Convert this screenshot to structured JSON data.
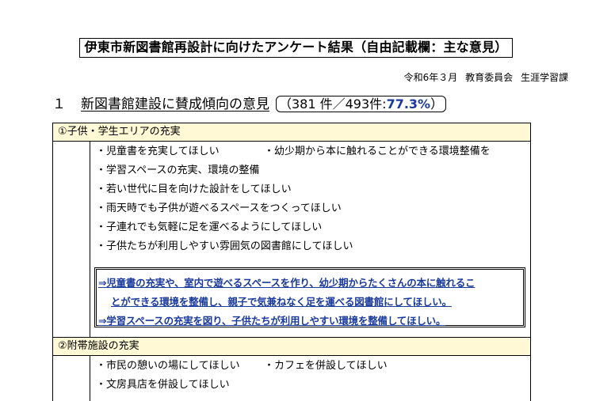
{
  "title": "伊東市新図書館再設計に向けたアンケート結果（自由記載欄：主な意見）",
  "dateline": {
    "date": "令和6年３月",
    "org": "教育委員会",
    "dept": "生涯学習課"
  },
  "section": {
    "number": "１",
    "title": "新図書館建設に賛成傾向の意見",
    "stat_prefix": "（381 件／493件:",
    "stat_percent": "77.3%",
    "stat_suffix": "）"
  },
  "categories": [
    {
      "heading": "①子供・学生エリアの充実",
      "items": [
        [
          "・児童書を充実してほしい",
          "・幼少期から本に触れることができる環境整備を"
        ],
        [
          "・学習スペースの充実、環境の整備",
          ""
        ],
        [
          "・若い世代に目を向けた設計をしてほしい",
          ""
        ],
        [
          "・雨天時でも子供が遊べるスペースをつくってほしい",
          ""
        ],
        [
          "・子連れでも気軽に足を運べるようにしてほしい",
          ""
        ],
        [
          "・子供たちが利用しやすい雰囲気の図書館にしてほしい",
          ""
        ]
      ],
      "summary": {
        "arrow": "⇒",
        "line1": "児童書の充実や、室内で遊べるスペースを作り、幼少期からたくさんの本に触れるこ",
        "line2": "とができる環境を整備し、親子で気兼ねなく足を運べる図書館にしてほしい。",
        "line3": "学習スペースの充実を図り、子供たちが利用しやすい環境を整備してほしい。"
      }
    },
    {
      "heading": "②附帯施設の充実",
      "items": [
        [
          "・市民の憩いの場にしてほしい",
          "・カフェを併設してほしい"
        ],
        [
          "・文房具店を併設してほしい",
          ""
        ]
      ]
    }
  ]
}
